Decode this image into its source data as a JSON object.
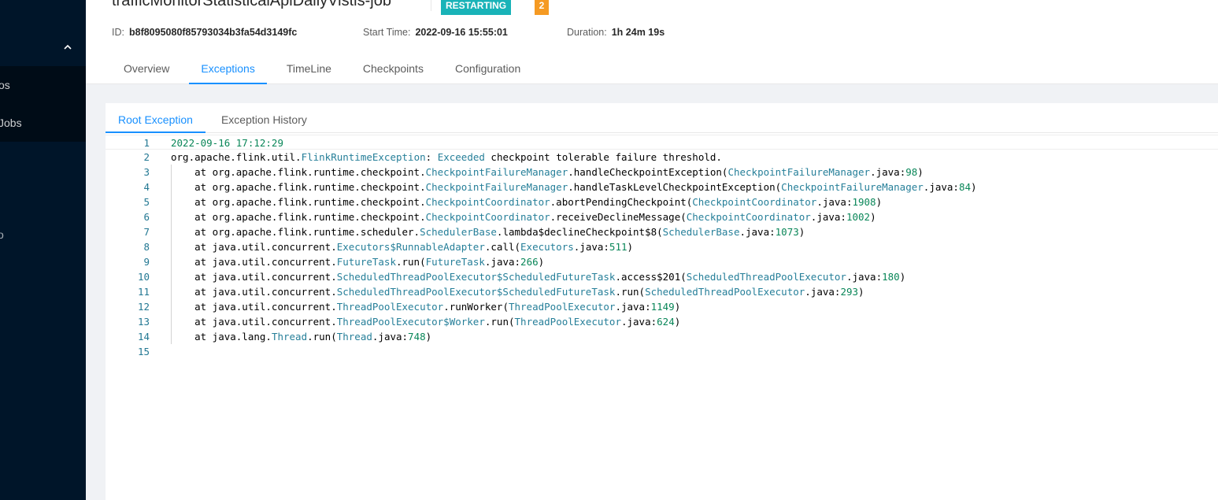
{
  "sidebar": {
    "sub_items": [
      "os",
      "Jobs"
    ],
    "fragment": "o"
  },
  "job": {
    "name": "trafficMonitorStatisticalApiDailyVistis-job",
    "status": "RESTARTING",
    "count": "2",
    "id_label": "ID:",
    "id": "b8f8095080f85793034b3fa54d3149fc",
    "start_label": "Start Time:",
    "start_time": "2022-09-16 15:55:01",
    "duration_label": "Duration:",
    "duration": "1h 24m 19s"
  },
  "tabs": [
    "Overview",
    "Exceptions",
    "TimeLine",
    "Checkpoints",
    "Configuration"
  ],
  "active_tab": "Exceptions",
  "subtabs": [
    "Root Exception",
    "Exception History"
  ],
  "active_subtab": "Root Exception",
  "colors": {
    "sidebar": "#001529",
    "accent": "#1890ff",
    "status": "#19b3b8",
    "count_badge": "#f59a23"
  },
  "exception_lines": [
    "2022-09-16 17:12:29",
    "org.apache.flink.util.FlinkRuntimeException: Exceeded checkpoint tolerable failure threshold.",
    "    at org.apache.flink.runtime.checkpoint.CheckpointFailureManager.handleCheckpointException(CheckpointFailureManager.java:98)",
    "    at org.apache.flink.runtime.checkpoint.CheckpointFailureManager.handleTaskLevelCheckpointException(CheckpointFailureManager.java:84)",
    "    at org.apache.flink.runtime.checkpoint.CheckpointCoordinator.abortPendingCheckpoint(CheckpointCoordinator.java:1908)",
    "    at org.apache.flink.runtime.checkpoint.CheckpointCoordinator.receiveDeclineMessage(CheckpointCoordinator.java:1002)",
    "    at org.apache.flink.runtime.scheduler.SchedulerBase.lambda$declineCheckpoint$8(SchedulerBase.java:1073)",
    "    at java.util.concurrent.Executors$RunnableAdapter.call(Executors.java:511)",
    "    at java.util.concurrent.FutureTask.run(FutureTask.java:266)",
    "    at java.util.concurrent.ScheduledThreadPoolExecutor$ScheduledFutureTask.access$201(ScheduledThreadPoolExecutor.java:180)",
    "    at java.util.concurrent.ScheduledThreadPoolExecutor$ScheduledFutureTask.run(ScheduledThreadPoolExecutor.java:293)",
    "    at java.util.concurrent.ThreadPoolExecutor.runWorker(ThreadPoolExecutor.java:1149)",
    "    at java.util.concurrent.ThreadPoolExecutor$Worker.run(ThreadPoolExecutor.java:624)",
    "    at java.lang.Thread.run(Thread.java:748)",
    ""
  ]
}
